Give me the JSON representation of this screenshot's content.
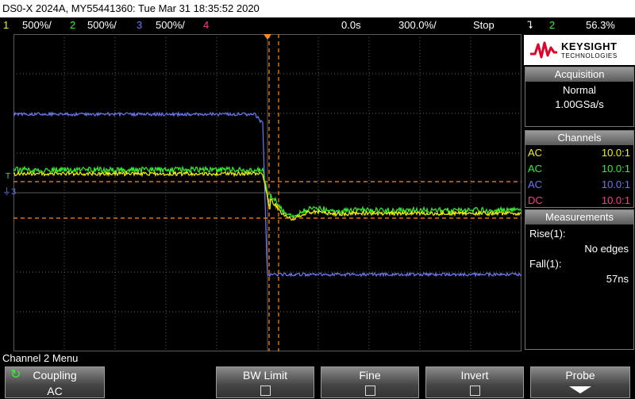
{
  "title": "DS0-X 2024A, MY55441360: Tue Mar 31 18:35:52 2020",
  "status": {
    "ch1_num": "1",
    "ch1_scale": "500%/",
    "ch2_num": "2",
    "ch2_scale": "500%/",
    "ch3_num": "3",
    "ch3_scale": "500%/",
    "ch4_num": "4",
    "time_offset": "0.0s",
    "time_scale": "300.0%/",
    "run_state": "Stop",
    "trigger_source": "2",
    "trigger_level": "56.3%"
  },
  "colors": {
    "ch1": "#f4f400",
    "ch2": "#30f030",
    "ch3": "#6a78f0",
    "ch4": "#ff3a8a",
    "cursor": "#ff8c1a"
  },
  "logo": {
    "name": "KEYSIGHT",
    "sub": "TECHNOLOGIES"
  },
  "acquisition": {
    "header": "Acquisition",
    "mode": "Normal",
    "rate": "1.00GSa/s"
  },
  "channels": {
    "header": "Channels",
    "items": [
      {
        "coupling": "AC",
        "probe": "10.0:1"
      },
      {
        "coupling": "AC",
        "probe": "10.0:1"
      },
      {
        "coupling": "AC",
        "probe": "10.0:1"
      },
      {
        "coupling": "DC",
        "probe": "10.0:1"
      }
    ]
  },
  "measurements": {
    "header": "Measurements",
    "rise_label": "Rise(1):",
    "rise_value": "No edges",
    "fall_label": "Fall(1):",
    "fall_value": "57ns"
  },
  "menu_title": "Channel 2 Menu",
  "softkeys": {
    "coupling_label": "Coupling",
    "coupling_value": "AC",
    "bw_limit": "BW Limit",
    "fine": "Fine",
    "invert": "Invert",
    "probe": "Probe"
  },
  "markers": {
    "ground3": "3",
    "trig": "T"
  }
}
